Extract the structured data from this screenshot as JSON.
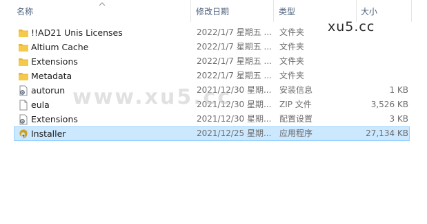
{
  "header": {
    "name": "名称",
    "date": "修改日期",
    "type": "类型",
    "size": "大小"
  },
  "files": [
    {
      "name": "!!AD21 Unis Licenses",
      "date": "2022/1/7 星期五 ...",
      "type": "文件夹",
      "size": "",
      "icon": "folder-icon"
    },
    {
      "name": "Altium Cache",
      "date": "2022/1/7 星期五 ...",
      "type": "文件夹",
      "size": "",
      "icon": "folder-icon"
    },
    {
      "name": "Extensions",
      "date": "2022/1/7 星期五 ...",
      "type": "文件夹",
      "size": "",
      "icon": "folder-icon"
    },
    {
      "name": "Metadata",
      "date": "2022/1/7 星期五 ...",
      "type": "文件夹",
      "size": "",
      "icon": "folder-icon"
    },
    {
      "name": "autorun",
      "date": "2021/12/30 星期...",
      "type": "安装信息",
      "size": "1 KB",
      "icon": "settings-file-icon"
    },
    {
      "name": "eula",
      "date": "2021/12/30 星期...",
      "type": "ZIP 文件",
      "size": "3,526 KB",
      "icon": "document-icon"
    },
    {
      "name": "Extensions",
      "date": "2021/12/30 星期...",
      "type": "配置设置",
      "size": "3 KB",
      "icon": "settings-file-icon"
    },
    {
      "name": "Installer",
      "date": "2021/12/25 星期...",
      "type": "应用程序",
      "size": "27,134 KB",
      "icon": "installer-app-icon",
      "selected": true
    }
  ],
  "watermarks": {
    "large": "www.xu5.cc",
    "small": "xu5.cc"
  },
  "colors": {
    "selection_bg": "#cce8ff",
    "selection_border": "#99d1ff",
    "folder": "#f5c94c",
    "header_text": "#4c607a"
  }
}
